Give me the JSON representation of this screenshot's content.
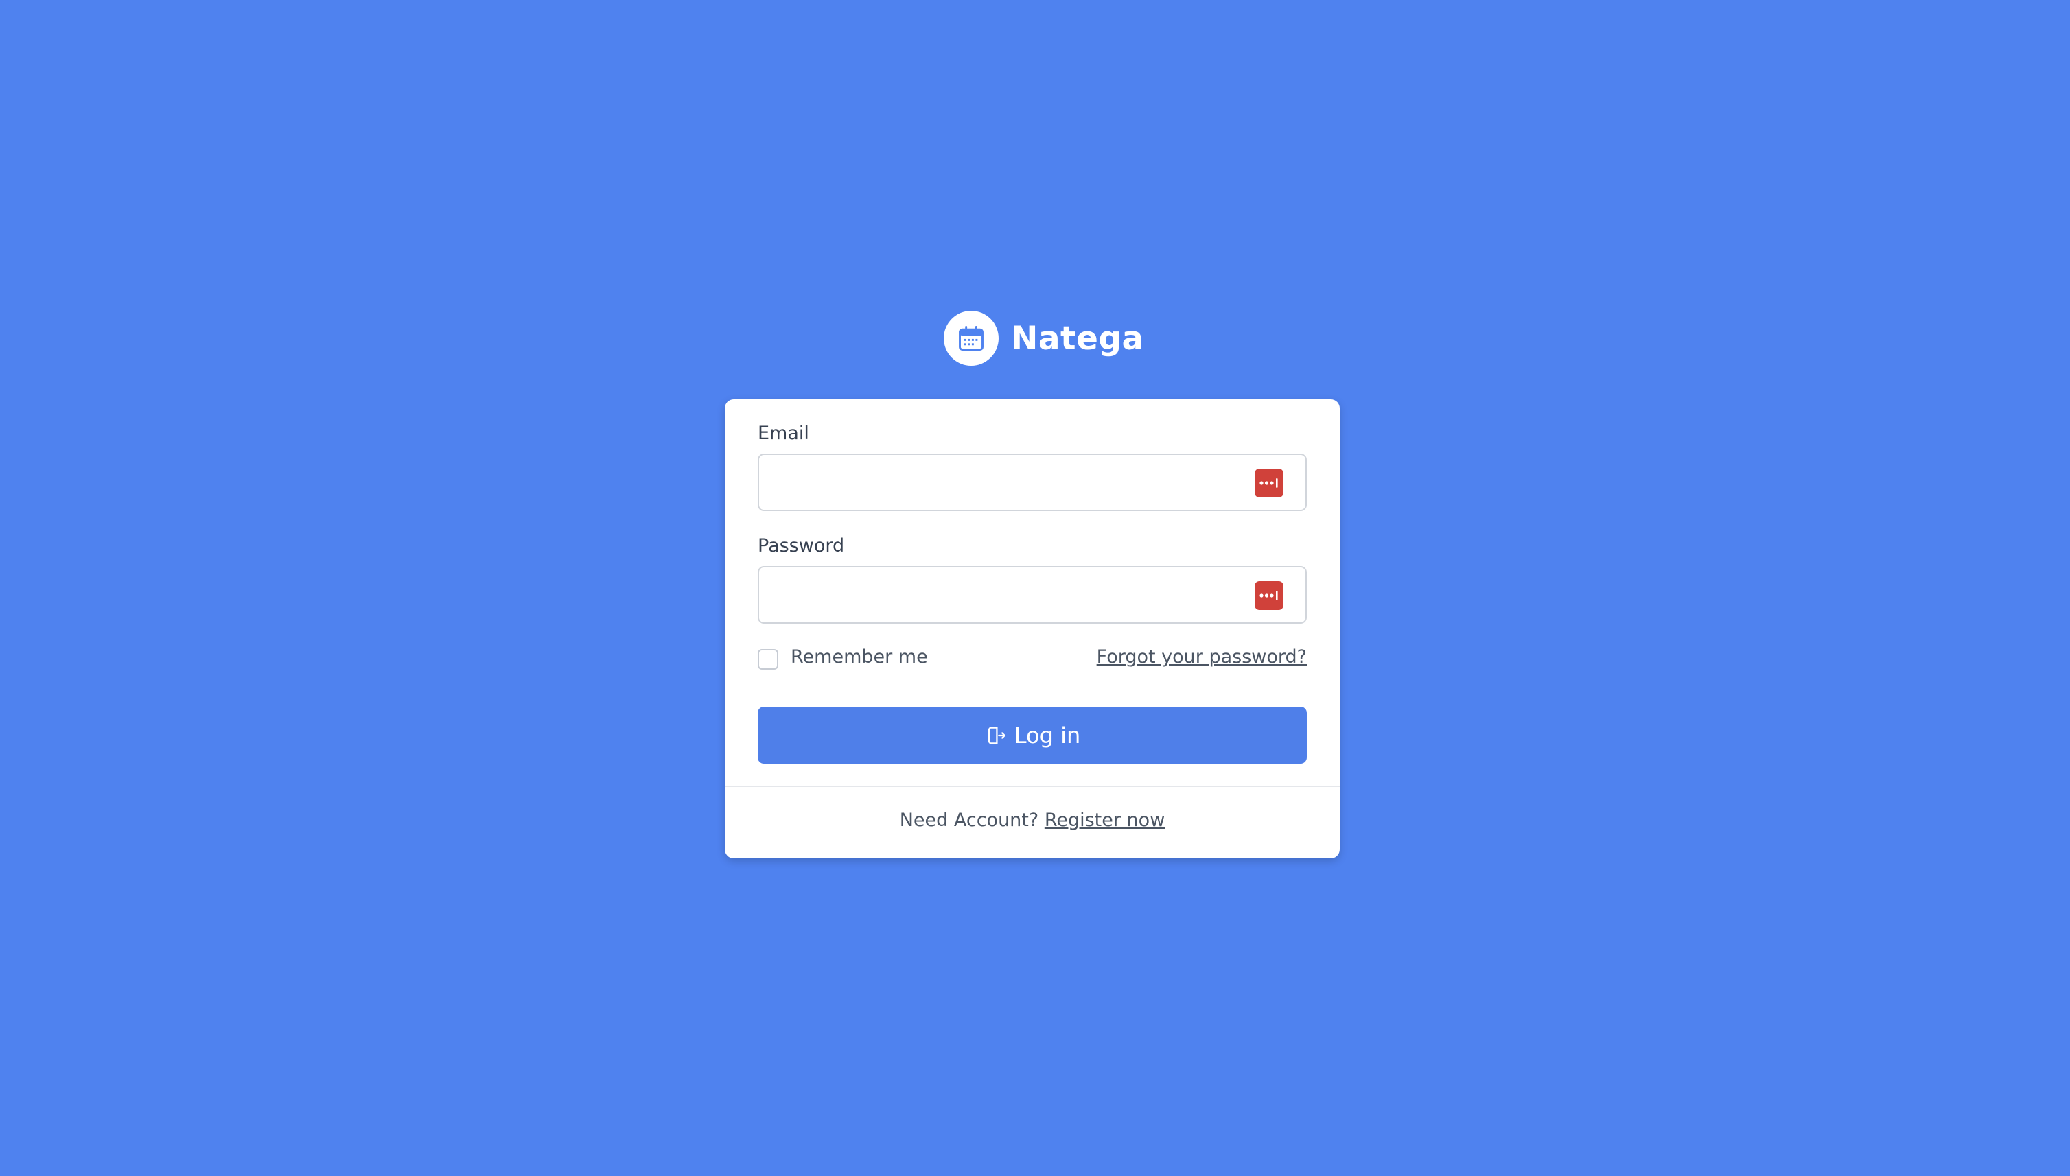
{
  "brand": {
    "name": "Natega",
    "logo_icon": "calendar-icon"
  },
  "login_form": {
    "email_label": "Email",
    "email_value": "",
    "password_label": "Password",
    "password_value": "",
    "field_extension_icon": "password-manager-icon",
    "remember_label": "Remember me",
    "remember_checked": false,
    "forgot_link": "Forgot your password?",
    "login_button": "Log in",
    "login_icon": "sign-in-icon"
  },
  "footer": {
    "prompt": "Need Account?",
    "register_link": "Register now"
  },
  "colors": {
    "background": "#4f82ef",
    "accent": "#4f7fe9",
    "password_manager": "#d0413a",
    "text": "#374151"
  }
}
